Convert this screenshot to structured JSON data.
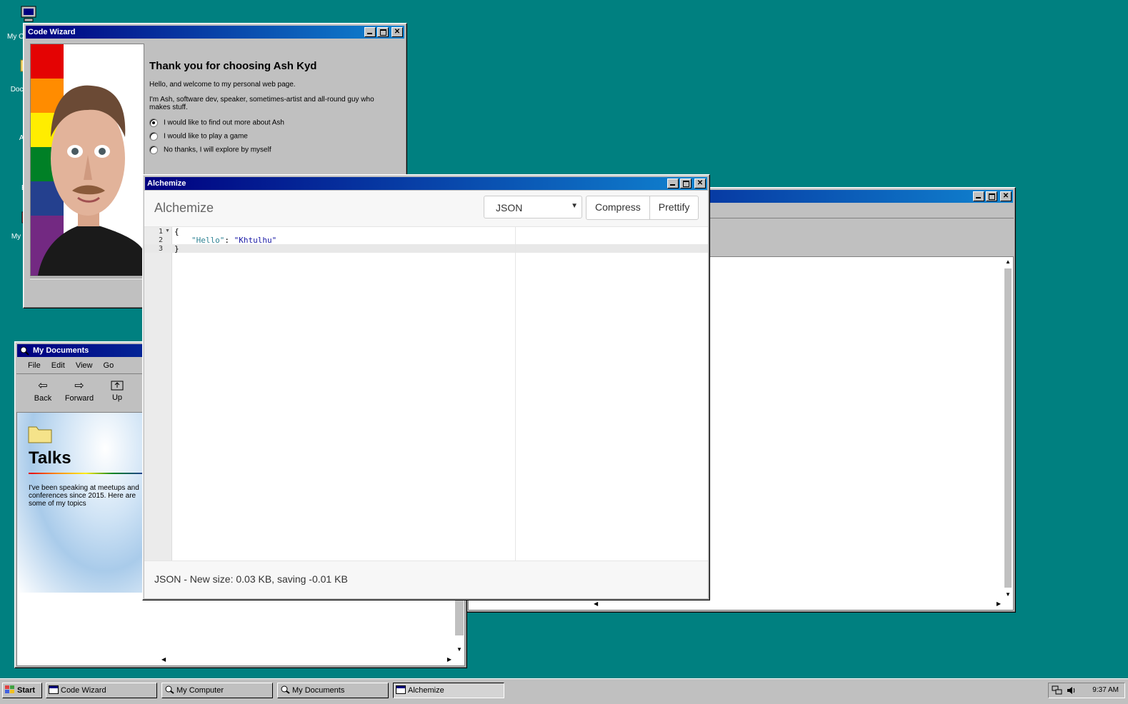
{
  "desktop": {
    "icons": [
      {
        "label": "My Computer",
        "icon": "computer-icon"
      },
      {
        "label": "Documents",
        "icon": "folder-icon"
      },
      {
        "label": "About",
        "icon": "document-icon"
      },
      {
        "label": "Blog",
        "icon": "document-icon"
      },
      {
        "label": "My Games",
        "icon": "gift-icon"
      }
    ]
  },
  "code_wizard": {
    "title": "Code Wizard",
    "heading": "Thank you for choosing Ash Kyd",
    "intro": "Hello, and welcome to my personal web page.",
    "about": "I'm Ash, software dev, speaker, sometimes-artist and all-round guy who makes stuff.",
    "options": [
      {
        "label": "I would like to find out more about Ash",
        "selected": true
      },
      {
        "label": "I would like to play a game",
        "selected": false
      },
      {
        "label": "No thanks, I will explore by myself",
        "selected": false
      }
    ],
    "flag_colors": [
      "#e40303",
      "#ff8c00",
      "#ffed00",
      "#008026",
      "#24408e",
      "#732982"
    ]
  },
  "my_documents": {
    "title": "My Documents",
    "menu": [
      "File",
      "Edit",
      "View",
      "Go"
    ],
    "toolbar": {
      "back": "Back",
      "forward": "Forward",
      "up": "Up"
    },
    "folder_title": "Talks",
    "folder_description": "I've been speaking at meetups and conferences since 2015. Here are some of my topics"
  },
  "alchemize": {
    "title": "Alchemize",
    "app_name": "Alchemize",
    "format_selected": "JSON",
    "compress_label": "Compress",
    "prettify_label": "Prettify",
    "editor_lines": [
      {
        "num": "1",
        "text": "{"
      },
      {
        "num": "2",
        "key": "\"Hello\"",
        "sep": ": ",
        "value": "\"Khtulhu\""
      },
      {
        "num": "3",
        "text": "}"
      }
    ],
    "status": "JSON - New size: 0.03 KB, saving -0.01 KB"
  },
  "taskbar": {
    "start_label": "Start",
    "tasks": [
      {
        "label": "Code Wizard",
        "icon": "window-icon"
      },
      {
        "label": "My Computer",
        "icon": "explorer-icon"
      },
      {
        "label": "My Documents",
        "icon": "explorer-icon"
      },
      {
        "label": "Alchemize",
        "icon": "window-icon"
      }
    ],
    "clock": "9:37 AM"
  }
}
